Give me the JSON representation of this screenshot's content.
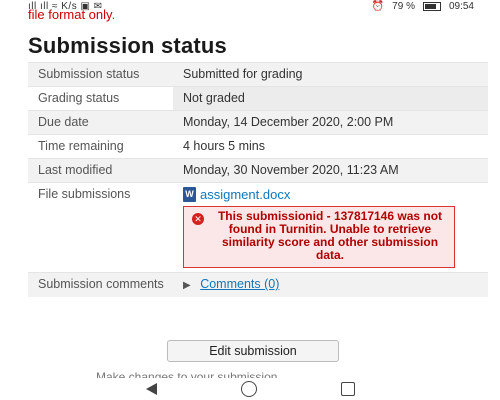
{
  "status_bar": {
    "left_icons": "ıll ıll ≈ K/s ▣ ✉",
    "alarm": "⏰",
    "battery_pct": "79 %",
    "time": "09:54"
  },
  "notice_text": "file format only.",
  "page_title": "Submission status",
  "rows": [
    {
      "label": "Submission status",
      "value": "Submitted for grading"
    },
    {
      "label": "Grading status",
      "value": "Not graded"
    },
    {
      "label": "Due date",
      "value": "Monday, 14 December 2020, 2:00 PM"
    },
    {
      "label": "Time remaining",
      "value": "4 hours 5 mins"
    },
    {
      "label": "Last modified",
      "value": "Monday, 30 November 2020, 11:23 AM"
    },
    {
      "label": "File submissions",
      "file_name": "assigment.docx",
      "error": "This submissionid - 137817146 was not found in Turnitin. Unable to retrieve similarity score and other submission data."
    },
    {
      "label": "Submission comments",
      "value": "Comments (0)"
    }
  ],
  "edit_button_label": "Edit submission",
  "cutoff_text": "Make changes to your submission",
  "icons": {
    "word": "W",
    "error": "✕",
    "expand": "▶"
  }
}
